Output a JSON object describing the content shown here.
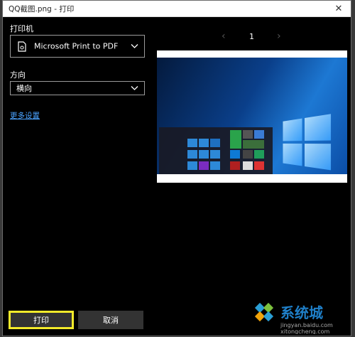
{
  "window": {
    "title": "QQ截图.png - 打印",
    "close_glyph": "✕"
  },
  "printer": {
    "label": "打印机",
    "selected": "Microsoft Print to PDF",
    "icon": "printer-icon"
  },
  "orientation": {
    "label": "方向",
    "selected": "横向"
  },
  "more_settings": "更多设置",
  "preview": {
    "page_number": "1",
    "prev_glyph": "‹",
    "next_glyph": "›"
  },
  "buttons": {
    "print": "打印",
    "cancel": "取消"
  },
  "watermark": {
    "brand": "系统城",
    "site1": "jingyan.baidu.com",
    "site2": "xitongcheng.com"
  },
  "colors": {
    "accent_link": "#4ba3ff",
    "highlight": "#f3ea2a"
  }
}
